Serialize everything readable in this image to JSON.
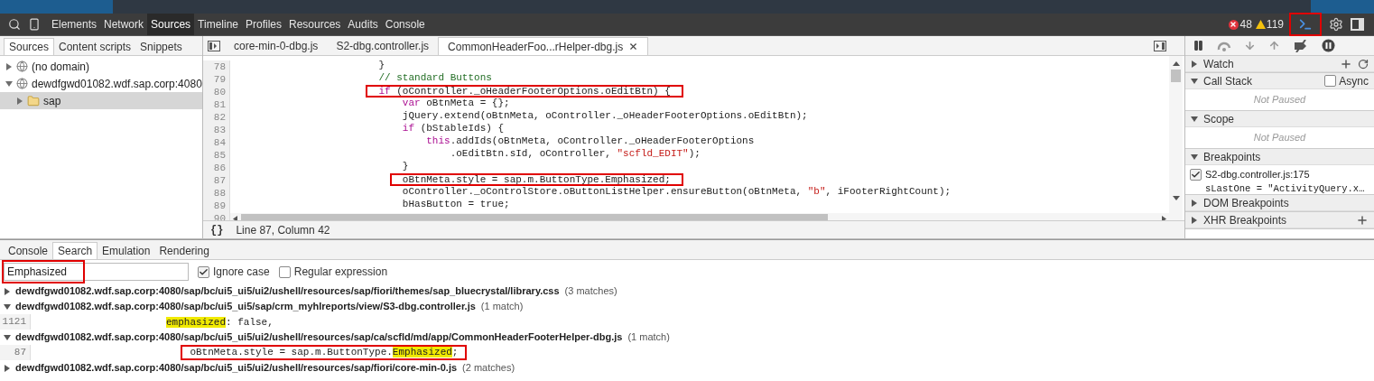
{
  "toolbar": {
    "tabs": [
      {
        "label": "Elements",
        "selected": false
      },
      {
        "label": "Network",
        "selected": false
      },
      {
        "label": "Sources",
        "selected": true
      },
      {
        "label": "Timeline",
        "selected": false
      },
      {
        "label": "Profiles",
        "selected": false
      },
      {
        "label": "Resources",
        "selected": false
      },
      {
        "label": "Audits",
        "selected": false
      },
      {
        "label": "Console",
        "selected": false
      }
    ],
    "errors": "48",
    "warnings": "119",
    "drawer_toggle": {
      "annotated": true
    }
  },
  "navigator": {
    "tabs": [
      {
        "label": "Sources",
        "selected": true
      },
      {
        "label": "Content scripts",
        "selected": false
      },
      {
        "label": "Snippets",
        "selected": false
      }
    ],
    "tree": [
      {
        "label": "(no domain)",
        "kind": "domain",
        "expanded": false,
        "selected": false
      },
      {
        "label": "dewdfgwd01082.wdf.sap.corp:4080",
        "kind": "domain",
        "expanded": true,
        "selected": false,
        "children": [
          {
            "label": "sap",
            "kind": "folder",
            "expanded": false,
            "selected": true
          }
        ]
      }
    ]
  },
  "editor": {
    "tabs": [
      {
        "label": "core-min-0-dbg.js",
        "selected": false
      },
      {
        "label": "S2-dbg.controller.js",
        "selected": false
      },
      {
        "label": "CommonHeaderFoo...rHelper-dbg.js",
        "selected": true
      }
    ],
    "lines": [
      {
        "number": "78",
        "annotated": false,
        "segments": [
          {
            "text": "                        }",
            "kind": "plain"
          }
        ]
      },
      {
        "number": "79",
        "annotated": false,
        "segments": [
          {
            "text": "                        // standard Buttons",
            "kind": "comment"
          }
        ]
      },
      {
        "number": "80",
        "annotated": true,
        "segments": [
          {
            "text": "                        if",
            "kind": "keyword"
          },
          {
            "text": " (oController._oHeaderFooterOptions.oEditBtn) {",
            "kind": "plain"
          }
        ]
      },
      {
        "number": "81",
        "annotated": false,
        "segments": [
          {
            "text": "                            var",
            "kind": "keyword"
          },
          {
            "text": " oBtnMeta = {};",
            "kind": "plain"
          }
        ]
      },
      {
        "number": "82",
        "annotated": false,
        "segments": [
          {
            "text": "                            jQuery.extend(oBtnMeta, oController._oHeaderFooterOptions.oEditBtn);",
            "kind": "plain"
          }
        ]
      },
      {
        "number": "83",
        "annotated": false,
        "segments": [
          {
            "text": "                            if",
            "kind": "keyword"
          },
          {
            "text": " (bStableIds) {",
            "kind": "plain"
          }
        ]
      },
      {
        "number": "84",
        "annotated": false,
        "segments": [
          {
            "text": "                                this",
            "kind": "keyword"
          },
          {
            "text": ".addIds(oBtnMeta, oController._oHeaderFooterOptions",
            "kind": "plain"
          }
        ]
      },
      {
        "number": "85",
        "annotated": false,
        "segments": [
          {
            "text": "                                    .oEditBtn.sId, oController, ",
            "kind": "plain"
          },
          {
            "text": "\"scfld_EDIT\"",
            "kind": "string"
          },
          {
            "text": ");",
            "kind": "plain"
          }
        ]
      },
      {
        "number": "86",
        "annotated": false,
        "segments": [
          {
            "text": "                            }",
            "kind": "plain"
          }
        ]
      },
      {
        "number": "87",
        "annotated": true,
        "segments": [
          {
            "text": "                            oBtnMeta.style = sap.m.ButtonType.Emphasized;",
            "kind": "plain"
          }
        ]
      },
      {
        "number": "88",
        "annotated": false,
        "segments": [
          {
            "text": "                            oController._oControlStore.oButtonListHelper.ensureButton(oBtnMeta, ",
            "kind": "plain"
          },
          {
            "text": "\"b\"",
            "kind": "string"
          },
          {
            "text": ", iFooterRightCount);",
            "kind": "plain"
          }
        ]
      },
      {
        "number": "89",
        "annotated": false,
        "segments": [
          {
            "text": "                            bHasButton = true;",
            "kind": "plain"
          }
        ]
      }
    ],
    "last_line_number": "90",
    "pretty_print": "{}",
    "status": "Line 87, Column 42"
  },
  "debugger": {
    "sections": [
      {
        "title": "Watch",
        "expanded": false,
        "add_button": true,
        "refresh_button": true
      },
      {
        "title": "Call Stack",
        "expanded": true,
        "async": {
          "label": "Async",
          "checked": false
        },
        "message": "Not Paused"
      },
      {
        "title": "Scope",
        "expanded": true,
        "message": "Not Paused"
      },
      {
        "title": "Breakpoints",
        "expanded": true,
        "breakpoints": [
          {
            "file": "S2-dbg.controller.js:175",
            "code": "sLastOne = \"ActivityQuery.x…",
            "checked": true
          }
        ]
      },
      {
        "title": "DOM Breakpoints",
        "expanded": false
      },
      {
        "title": "XHR Breakpoints",
        "expanded": false,
        "add_button": true
      }
    ]
  },
  "drawer": {
    "tabs": [
      {
        "label": "Console",
        "selected": false
      },
      {
        "label": "Search",
        "selected": true
      },
      {
        "label": "Emulation",
        "selected": false
      },
      {
        "label": "Rendering",
        "selected": false
      }
    ],
    "search": {
      "value": "Emphasized",
      "annotated": true
    },
    "options": [
      {
        "label": "Ignore case",
        "checked": true
      },
      {
        "label": "Regular expression",
        "checked": false
      }
    ],
    "results": [
      {
        "path": "dewdfgwd01082.wdf.sap.corp:4080/sap/bc/ui5_ui5/ui2/ushell/resources/sap/fiori/themes/sap_bluecrystal/library.css",
        "count": "(3 matches)",
        "expanded": false
      },
      {
        "path": "dewdfgwd01082.wdf.sap.corp:4080/sap/bc/ui5_ui5/sap/crm_myhlreports/view/S3-dbg.controller.js",
        "count": "(1 match)",
        "expanded": true,
        "matches": [
          {
            "line": "1121",
            "match": "emphasized",
            "after": ": false,",
            "annotated": false
          }
        ]
      },
      {
        "path": "dewdfgwd01082.wdf.sap.corp:4080/sap/bc/ui5_ui5/ui2/ushell/resources/sap/ca/scfld/md/app/CommonHeaderFooterHelper-dbg.js",
        "count": "(1 match)",
        "expanded": true,
        "matches": [
          {
            "line": "87",
            "before": "    oBtnMeta.style = sap.m.ButtonType.",
            "match": "Emphasized",
            "after": ";",
            "annotated": true
          }
        ]
      },
      {
        "path": "dewdfgwd01082.wdf.sap.corp:4080/sap/bc/ui5_ui5/ui2/ushell/resources/sap/fiori/core-min-0.js",
        "count": "(2 matches)",
        "expanded": false
      }
    ]
  }
}
